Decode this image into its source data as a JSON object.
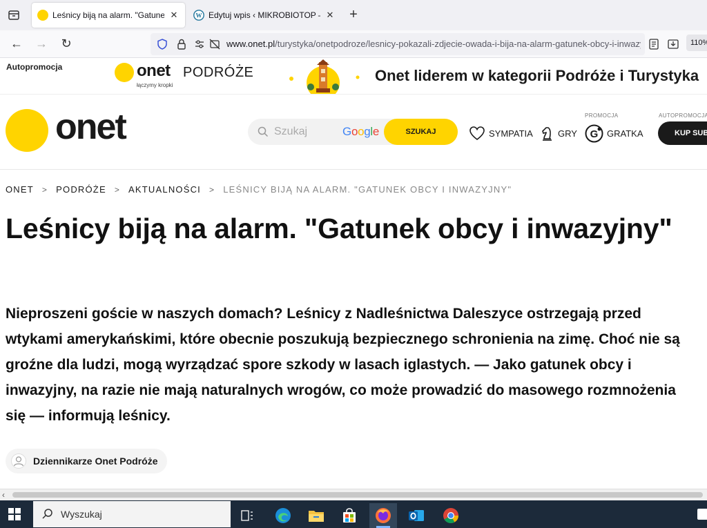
{
  "browser": {
    "tabs": [
      {
        "title": "Leśnicy biją na alarm. \"Gatunek",
        "active": true
      },
      {
        "title": "Edytuj wpis ‹ MIKROBIOTOP — W",
        "active": false
      }
    ],
    "url": {
      "domain": "www.onet.pl",
      "path": "/turystyka/onetpodroze/lesnicy-pokazali-zdjecie-owada-i-bija-na-alarm-gatunek-obcy-i-inwazyjny/"
    },
    "zoom": "110%"
  },
  "promo": {
    "label": "Autopromocja",
    "brand": "onet",
    "brand_section": "PODRÓŻE",
    "brand_tagline": "łączymy kropki",
    "headline": "Onet liderem w kategorii Podróże i Turystyka"
  },
  "header": {
    "logo": "onet",
    "search_placeholder": "Szukaj",
    "search_provider": "Google",
    "search_button": "SZUKAJ",
    "links": {
      "sympatia": "SYMPATIA",
      "gry": "GRY",
      "gratka": "GRATKA",
      "gratka_tag": "PROMOCJA",
      "kup_tag": "AUTOPROMOCJA",
      "kup": "KUP SUB"
    }
  },
  "breadcrumb": [
    "ONET",
    "PODRÓŻE",
    "AKTUALNOŚCI",
    "LEŚNICY BIJĄ NA ALARM. \"GATUNEK OBCY I INWAZYJNY\""
  ],
  "article": {
    "title": "Leśnicy biją na alarm. \"Gatunek obcy i inwazyjny\"",
    "lead": "Nieproszeni goście w naszych domach? Leśnicy z Nadleśnictwa Daleszyce ostrzegają przed wtykami amerykańskimi, które obecnie poszukują bezpiecznego schronienia na zimę. Choć nie są groźne dla ludzi, mogą wyrządzać spore szkody w lasach iglastych. — Jako gatunek obcy i inwazyjny, na razie nie mają naturalnych wrogów, co może prowadzić do masowego rozmnożenia się — informują leśnicy.",
    "author": "Dziennikarze Onet Podróże"
  },
  "taskbar": {
    "search_placeholder": "Wyszukaj",
    "apps": [
      "task-view-icon",
      "edge-icon",
      "file-explorer-icon",
      "store-icon",
      "firefox-icon",
      "outlook-icon",
      "chrome-icon"
    ]
  },
  "colors": {
    "onet_yellow": "#ffd400",
    "text": "#111111",
    "taskbar": "#1c2a3a"
  }
}
